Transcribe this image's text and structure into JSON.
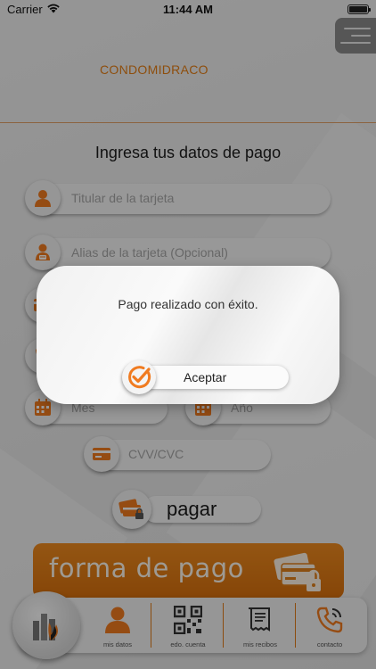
{
  "status_bar": {
    "carrier": "Carrier",
    "time": "11:44 AM"
  },
  "header": {
    "brand": "CONDOMIDRACO"
  },
  "form": {
    "title": "Ingresa tus datos de pago",
    "card_holder_placeholder": "Titular de la tarjeta",
    "card_alias_placeholder": "Alias de la tarjeta (Opcional)",
    "month_placeholder": "Mes",
    "year_placeholder": "Año",
    "cvv_placeholder": "CVV/CVC",
    "pay_label": "pagar"
  },
  "payment_method": {
    "label": "forma de pago"
  },
  "nav": {
    "items": [
      {
        "label": "mis datos",
        "icon": "user-icon"
      },
      {
        "label": "edo. cuenta",
        "icon": "qr-code-icon"
      },
      {
        "label": "mis recibos",
        "icon": "receipt-icon"
      },
      {
        "label": "contacto",
        "icon": "phone-icon"
      }
    ]
  },
  "alert": {
    "message": "Pago realizado con éxito.",
    "accept_label": "Aceptar"
  },
  "colors": {
    "accent": "#E57F16",
    "icon_accent": "#F07B20"
  }
}
